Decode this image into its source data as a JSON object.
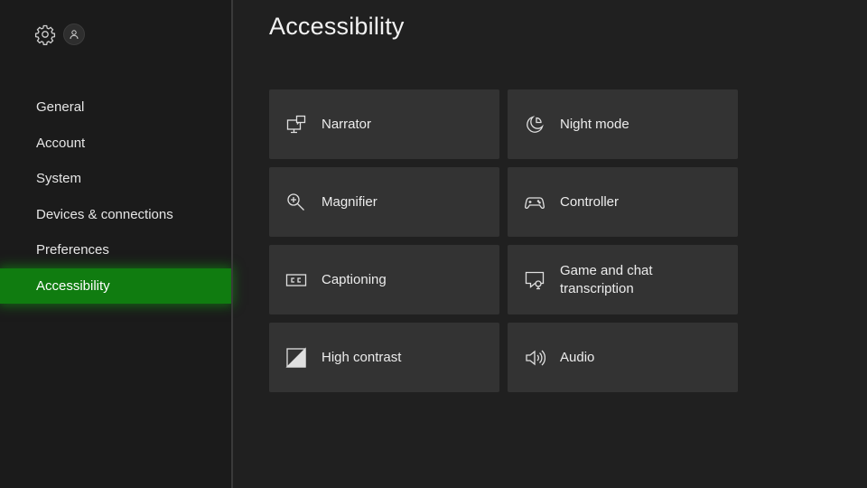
{
  "sidebar": {
    "items": [
      {
        "label": "General"
      },
      {
        "label": "Account"
      },
      {
        "label": "System"
      },
      {
        "label": "Devices & connections"
      },
      {
        "label": "Preferences"
      },
      {
        "label": "Accessibility",
        "selected": true
      }
    ],
    "accent_color": "#107c10"
  },
  "header": {
    "title": "Accessibility",
    "icons": [
      "gear-icon",
      "avatar-icon"
    ]
  },
  "tiles": [
    {
      "label": "Narrator",
      "icon": "narrator-icon"
    },
    {
      "label": "Night mode",
      "icon": "night-mode-icon"
    },
    {
      "label": "Magnifier",
      "icon": "magnifier-icon"
    },
    {
      "label": "Controller",
      "icon": "controller-icon"
    },
    {
      "label": "Captioning",
      "icon": "captioning-icon"
    },
    {
      "label": "Game and chat\ntranscription",
      "icon": "transcription-icon"
    },
    {
      "label": "High contrast",
      "icon": "high-contrast-icon"
    },
    {
      "label": "Audio",
      "icon": "audio-icon"
    }
  ]
}
